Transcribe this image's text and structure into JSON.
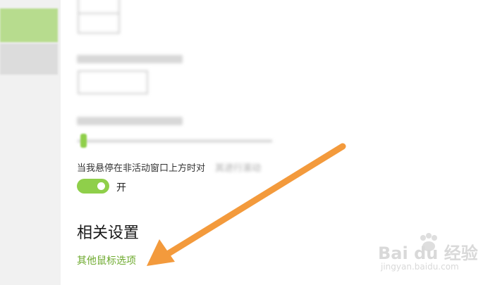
{
  "settings": {
    "hover_scroll_label": "当我悬停在非活动窗口上方时对其进行滚动",
    "hover_scroll_visible": "当我悬停在非活动窗口上方时对",
    "hover_scroll_blurred": "其进行滚动",
    "toggle_state_label": "开",
    "toggle_on": true,
    "related_title": "相关设置",
    "other_mouse_options_link": "其他鼠标选项"
  },
  "colors": {
    "accent": "#8fcf4a",
    "link": "#6eaa2e",
    "annotation_arrow": "#f39a3c"
  },
  "watermark": {
    "brand": "Bai du 经验",
    "url": "jingyan.baidu.com"
  }
}
